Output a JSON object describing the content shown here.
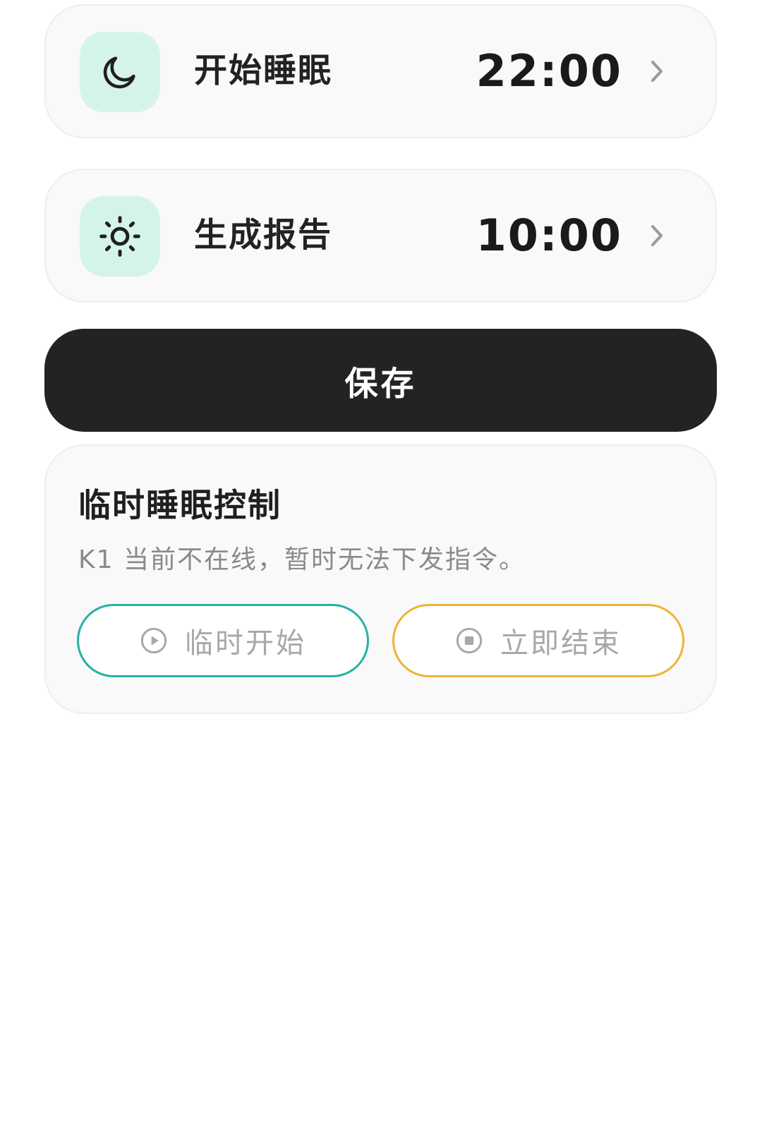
{
  "schedule": {
    "sleep": {
      "label": "开始睡眠",
      "time": "22:00",
      "icon": "moon-icon"
    },
    "report": {
      "label": "生成报告",
      "time": "10:00",
      "icon": "sun-icon"
    }
  },
  "save_button": {
    "label": "保存"
  },
  "temp_control": {
    "title": "临时睡眠控制",
    "subtitle": "K1 当前不在线，暂时无法下发指令。",
    "start_button": {
      "label": "临时开始",
      "icon": "play-circle-icon"
    },
    "stop_button": {
      "label": "立即结束",
      "icon": "stop-circle-icon"
    }
  },
  "colors": {
    "icon_bg": "#d5f4e8",
    "save_bg": "#232326",
    "start_border": "#25b3a6",
    "stop_border": "#eeb437"
  }
}
